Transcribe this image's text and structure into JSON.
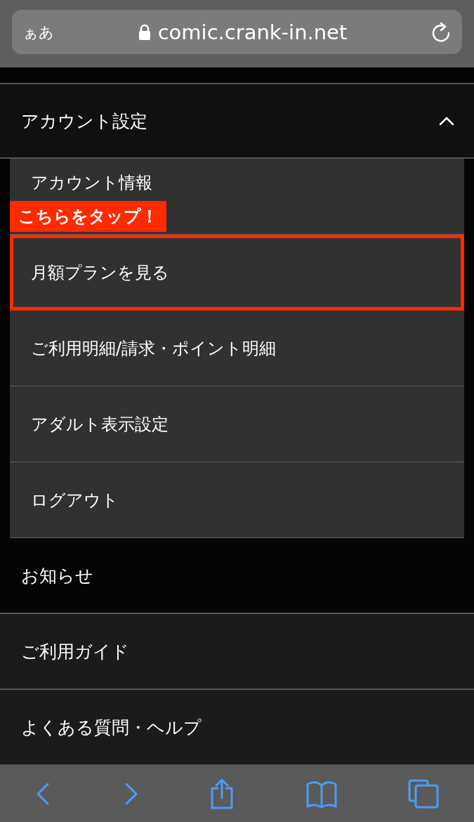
{
  "browser": {
    "text_size_button": "ぁあ",
    "url": "comic.crank-in.net"
  },
  "menu": {
    "section": {
      "label": "アカウント設定",
      "expanded": true
    },
    "callout": "こちらをタップ！",
    "items": [
      {
        "label": "アカウント情報",
        "highlighted": false
      },
      {
        "label": "月額プランを見る",
        "highlighted": true
      },
      {
        "label": "ご利用明細/請求・ポイント明細",
        "highlighted": false
      },
      {
        "label": "アダルト表示設定",
        "highlighted": false
      },
      {
        "label": "ログアウト",
        "highlighted": false
      }
    ],
    "links": [
      "お知らせ",
      "ご利用ガイド",
      "よくある質問・ヘルプ"
    ]
  }
}
